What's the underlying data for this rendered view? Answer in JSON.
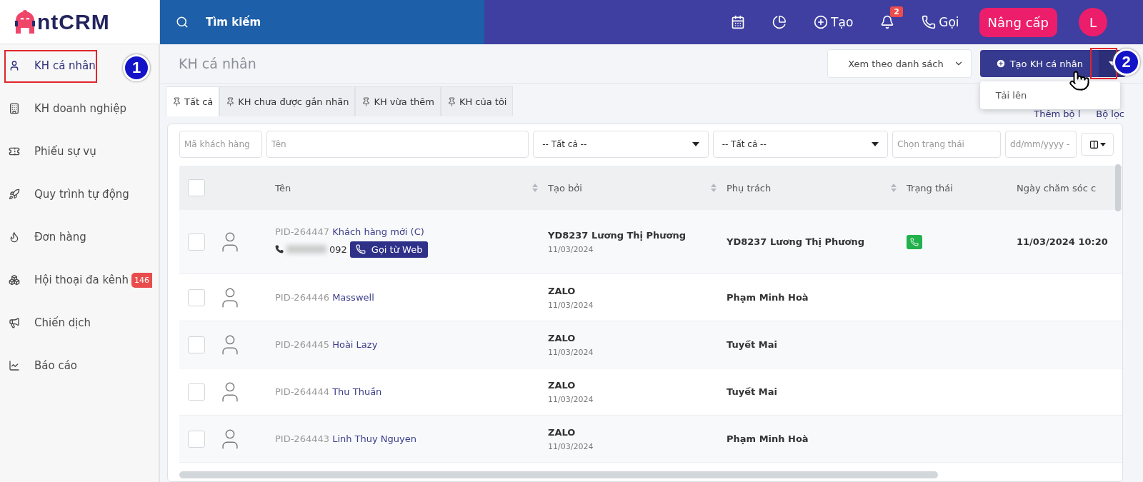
{
  "logo": {
    "text": "ntCRM"
  },
  "topbar": {
    "search": "Tìm kiếm",
    "create": "Tạo",
    "notifications": "2",
    "call": "Gọi",
    "upgrade": "Nâng cấp",
    "avatar": "L"
  },
  "sidebar": {
    "items": [
      {
        "label": "KH cá nhân",
        "selected": true,
        "marker": "1"
      },
      {
        "label": "KH doanh nghiệp",
        "selected": false
      },
      {
        "label": "Phiếu sự vụ",
        "selected": false
      },
      {
        "label": "Quy trình tự động",
        "selected": false
      },
      {
        "label": "Đơn hàng",
        "selected": false
      },
      {
        "label": "Hội thoại đa kênh",
        "selected": false,
        "badge": "146"
      },
      {
        "label": "Chiến dịch",
        "selected": false
      },
      {
        "label": "Báo cáo",
        "selected": false
      }
    ]
  },
  "page": {
    "title": "KH cá nhân",
    "view_select": "Xem theo danh sách",
    "create_button": {
      "label": "Tạo KH cá nhân",
      "marker": "2"
    },
    "menu": [
      "Tải lên"
    ],
    "filter_links": [
      "Thêm bộ l",
      "Bộ lọc"
    ]
  },
  "tabs": [
    {
      "label": "Tất cả",
      "selected": true
    },
    {
      "label": "KH chưa được gắn nhãn",
      "selected": false
    },
    {
      "label": "KH vừa thêm",
      "selected": false
    },
    {
      "label": "KH của tôi",
      "selected": false
    }
  ],
  "filters": [
    {
      "kind": "input",
      "placeholder": "Mã khách hàng"
    },
    {
      "kind": "input",
      "placeholder": "Tên"
    },
    {
      "kind": "select",
      "value": "-- Tất cả --"
    },
    {
      "kind": "select",
      "value": "-- Tất cả --"
    },
    {
      "kind": "input",
      "placeholder": "Chọn trạng thái"
    },
    {
      "kind": "input",
      "placeholder": "dd/mm/yyyy - "
    }
  ],
  "table": {
    "columns": [
      {
        "label": "Tên",
        "sortable": true
      },
      {
        "label": "Tạo bởi",
        "sortable": true
      },
      {
        "label": "Phụ trách",
        "sortable": true
      },
      {
        "label": "Trạng thái",
        "sortable": false
      },
      {
        "label": "Ngày chăm sóc c",
        "sortable": false
      }
    ],
    "header_checked": false,
    "rows": [
      {
        "checked": false,
        "id": "PID-264447",
        "name": "Khách hàng mới (C)",
        "phone_tail": "092",
        "call_button": "Gọi từ Web",
        "created_by": "YD8237 Lương Thị Phương",
        "created_date": "11/03/2024",
        "owner": "YD8237 Lương Thị Phương",
        "called": true,
        "care_date": "11/03/2024 10:20"
      },
      {
        "checked": false,
        "id": "PID-264446",
        "name": "Masswell",
        "called": false,
        "created_by": "ZALO",
        "created_date": "11/03/2024",
        "owner": "Phạm Minh Hoà"
      },
      {
        "checked": false,
        "id": "PID-264445",
        "name": "Hoài Lazy",
        "called": false,
        "created_by": "ZALO",
        "created_date": "11/03/2024",
        "owner": "Tuyết Mai"
      },
      {
        "checked": false,
        "id": "PID-264444",
        "name": "Thu Thuần",
        "called": false,
        "created_by": "ZALO",
        "created_date": "11/03/2024",
        "owner": "Tuyết Mai"
      },
      {
        "checked": false,
        "id": "PID-264443",
        "name": "Linh Thuy Nguyen",
        "called": false,
        "created_by": "ZALO",
        "created_date": "11/03/2024",
        "owner": "Phạm Minh Hoà"
      }
    ]
  }
}
